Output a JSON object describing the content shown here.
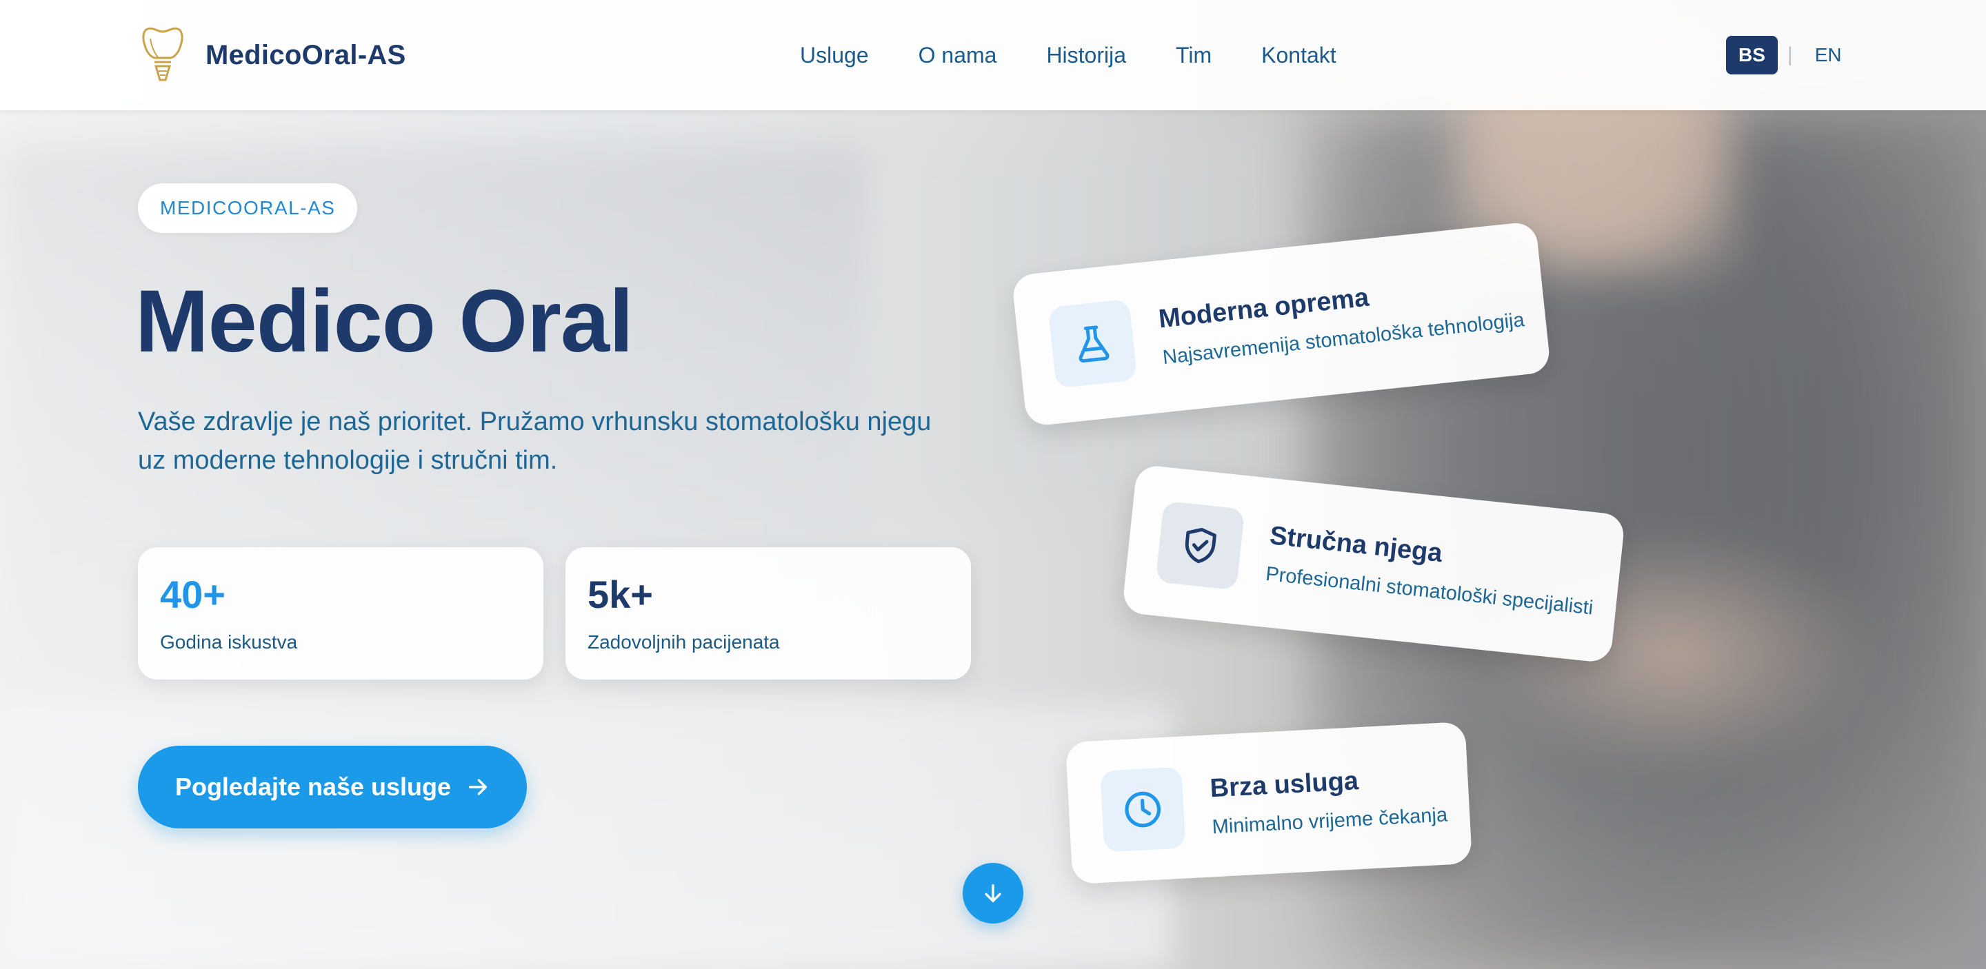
{
  "header": {
    "brand": "MedicoOral-AS",
    "nav": [
      "Usluge",
      "O nama",
      "Historija",
      "Tim",
      "Kontakt"
    ],
    "languages": {
      "active": "BS",
      "other": "EN"
    }
  },
  "hero": {
    "badge": "MEDICOORAL-AS",
    "title": "Medico Oral",
    "subtitle": "Vaše zdravlje je naš prioritet. Pružamo vrhunsku stomatološku njegu uz moderne tehnologije i stručni tim.",
    "stats": [
      {
        "value": "40+",
        "label": "Godina iskustva"
      },
      {
        "value": "5k+",
        "label": "Zadovoljnih pacijenata"
      }
    ],
    "cta": "Pogledajte naše usluge"
  },
  "features": [
    {
      "title": "Moderna oprema",
      "description": "Najsavremenija stomatološka tehnologija",
      "icon": "flask-icon"
    },
    {
      "title": "Stručna njega",
      "description": "Profesionalni stomatološki specijalisti",
      "icon": "shield-check-icon"
    },
    {
      "title": "Brza usluga",
      "description": "Minimalno vrijeme čekanja",
      "icon": "clock-icon"
    }
  ],
  "colors": {
    "primary": "#1b9ae9",
    "navy": "#1d3a6b",
    "link": "#1a5a8c",
    "gold": "#c9a24a"
  }
}
